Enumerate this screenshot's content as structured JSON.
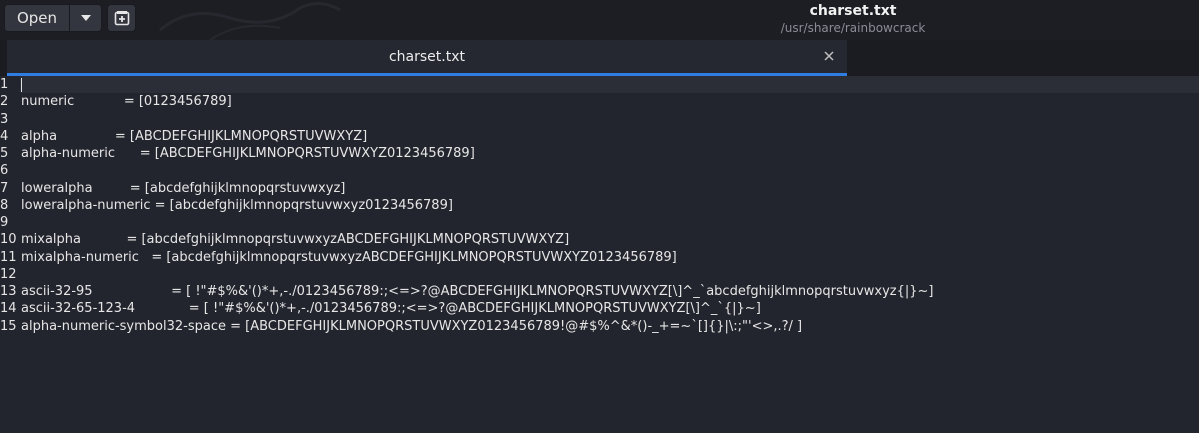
{
  "header": {
    "open_label": "Open",
    "title": "charset.txt",
    "subtitle": "/usr/share/rainbowcrack"
  },
  "tab": {
    "label": "charset.txt"
  },
  "editor": {
    "lines": [
      {
        "num": "1",
        "text": ""
      },
      {
        "num": "2",
        "text": "numeric            = [0123456789]"
      },
      {
        "num": "3",
        "text": ""
      },
      {
        "num": "4",
        "text": "alpha              = [ABCDEFGHIJKLMNOPQRSTUVWXYZ]"
      },
      {
        "num": "5",
        "text": "alpha-numeric      = [ABCDEFGHIJKLMNOPQRSTUVWXYZ0123456789]"
      },
      {
        "num": "6",
        "text": ""
      },
      {
        "num": "7",
        "text": "loweralpha         = [abcdefghijklmnopqrstuvwxyz]"
      },
      {
        "num": "8",
        "text": "loweralpha-numeric = [abcdefghijklmnopqrstuvwxyz0123456789]"
      },
      {
        "num": "9",
        "text": ""
      },
      {
        "num": "10",
        "text": "mixalpha           = [abcdefghijklmnopqrstuvwxyzABCDEFGHIJKLMNOPQRSTUVWXYZ]"
      },
      {
        "num": "11",
        "text": "mixalpha-numeric   = [abcdefghijklmnopqrstuvwxyzABCDEFGHIJKLMNOPQRSTUVWXYZ0123456789]"
      },
      {
        "num": "12",
        "text": ""
      },
      {
        "num": "13",
        "text": "ascii-32-95                   = [ !\"#$%&'()*+,-./0123456789:;<=>?@ABCDEFGHIJKLMNOPQRSTUVWXYZ[\\]^_`abcdefghijklmnopqrstuvwxyz{|}~]"
      },
      {
        "num": "14",
        "text": "ascii-32-65-123-4             = [ !\"#$%&'()*+,-./0123456789:;<=>?@ABCDEFGHIJKLMNOPQRSTUVWXYZ[\\]^_`{|}~]"
      },
      {
        "num": "15",
        "text": "alpha-numeric-symbol32-space = [ABCDEFGHIJKLMNOPQRSTUVWXYZ0123456789!@#$%^&*()-_+=~`[]{}|\\:;\"'<>,.?/ ]"
      }
    ]
  }
}
